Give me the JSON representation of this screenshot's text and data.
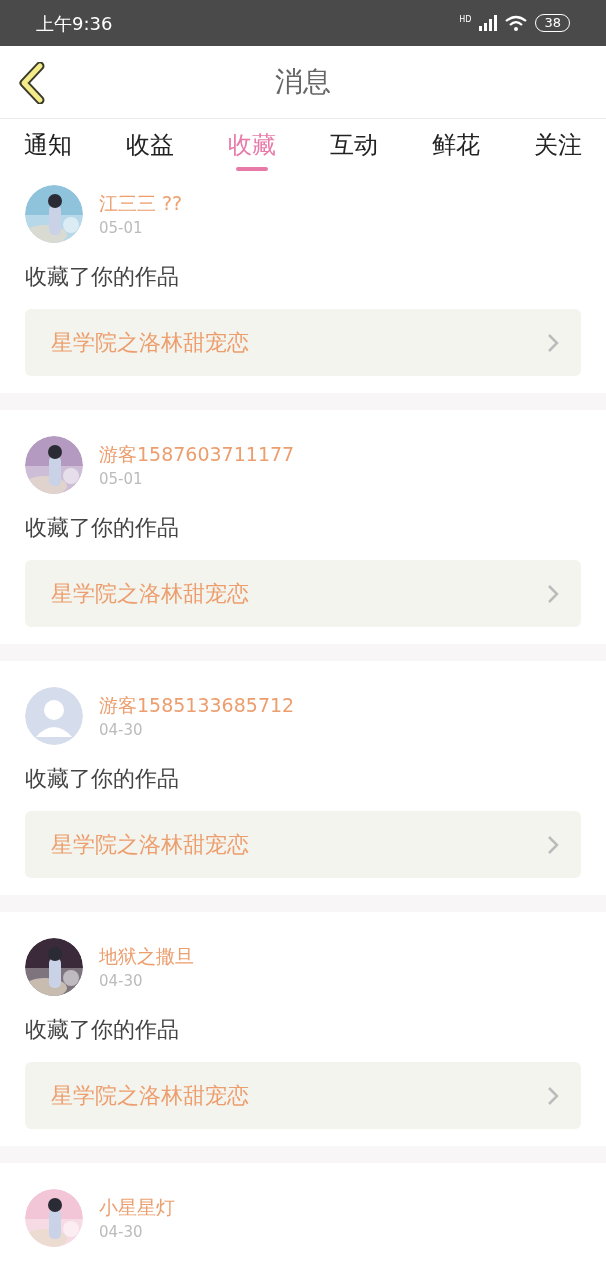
{
  "status_bar": {
    "time": "上午9:36",
    "network": "HD",
    "battery": "38"
  },
  "header": {
    "title": "消息"
  },
  "tabs": [
    {
      "label": "通知",
      "selected": false
    },
    {
      "label": "收益",
      "selected": false
    },
    {
      "label": "收藏",
      "selected": true
    },
    {
      "label": "互动",
      "selected": false
    },
    {
      "label": "鲜花",
      "selected": false
    },
    {
      "label": "关注",
      "selected": false
    }
  ],
  "messages": [
    {
      "user": "江三三 ??",
      "date": "05-01",
      "action": "收藏了你的作品",
      "work": "星学院之洛林甜宠恋"
    },
    {
      "user": "游客1587603711177",
      "date": "05-01",
      "action": "收藏了你的作品",
      "work": "星学院之洛林甜宠恋"
    },
    {
      "avatar": {
        "kind": "default",
        "color": "#d5dcec"
      },
      "user": "游客1585133685712",
      "date": "04-30",
      "action": "收藏了你的作品",
      "work": "星学院之洛林甜宠恋"
    },
    {
      "user": "地狱之撒旦",
      "date": "04-30",
      "action": "收藏了你的作品",
      "work": "星学院之洛林甜宠恋"
    },
    {
      "user": "小星星灯",
      "date": "04-30"
    }
  ]
}
